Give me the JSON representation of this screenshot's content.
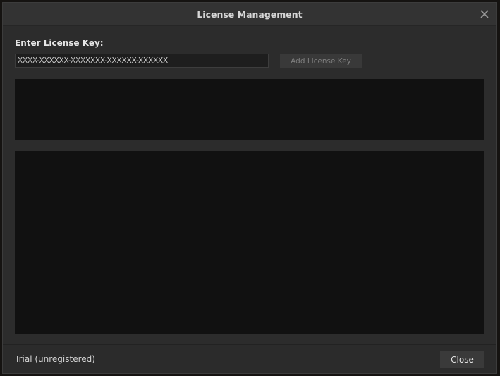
{
  "dialog": {
    "title": "License Management",
    "close_icon": "close-icon"
  },
  "license_key": {
    "label": "Enter License Key:",
    "value": "XXXX-XXXXXX-XXXXXXX-XXXXXX-XXXXXX",
    "add_button_label": "Add License Key"
  },
  "footer": {
    "status": "Trial (unregistered)",
    "close_button_label": "Close"
  },
  "colors": {
    "caret": "#e8c36a",
    "panel_background": "#111111",
    "dialog_background": "#2c2c2c"
  }
}
